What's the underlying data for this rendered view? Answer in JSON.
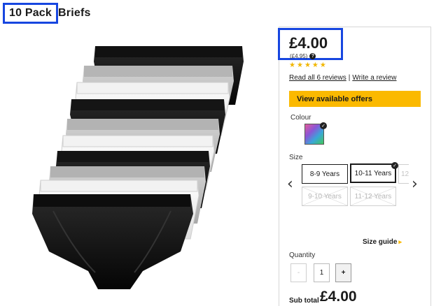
{
  "product": {
    "title_highlight": "10 Pack",
    "title_rest": "Briefs",
    "price": "£4.00",
    "price_note": "(£4.95)",
    "rating_stars": 5,
    "reviews_link": "Read all 6 reviews",
    "review_separator": "|",
    "write_review_link": "Write a review"
  },
  "offers_button": "View available offers",
  "colour": {
    "label": "Colour",
    "swatch_colors": [
      "#e35b9a",
      "#8b55d6",
      "#3aa6d8",
      "#42c85a"
    ]
  },
  "size": {
    "label": "Size",
    "options": [
      {
        "label": "8-9 Years",
        "state": "available"
      },
      {
        "label": "10-11 Years",
        "state": "selected"
      },
      {
        "label": "12",
        "state": "partial"
      },
      {
        "label": "9-10 Years",
        "state": "out-of-stock"
      },
      {
        "label": "11-12 Years",
        "state": "out-of-stock"
      }
    ],
    "guide_link": "Size guide",
    "guide_arrow": "▸"
  },
  "quantity": {
    "label": "Quantity",
    "minus": "-",
    "value": "1",
    "plus": "+"
  },
  "subtotal": {
    "label": "Sub total",
    "value": "£4.00"
  },
  "colors": {
    "accent_yellow": "#fbb900",
    "highlight_blue": "#1746e0",
    "star_color": "#f1b600"
  }
}
